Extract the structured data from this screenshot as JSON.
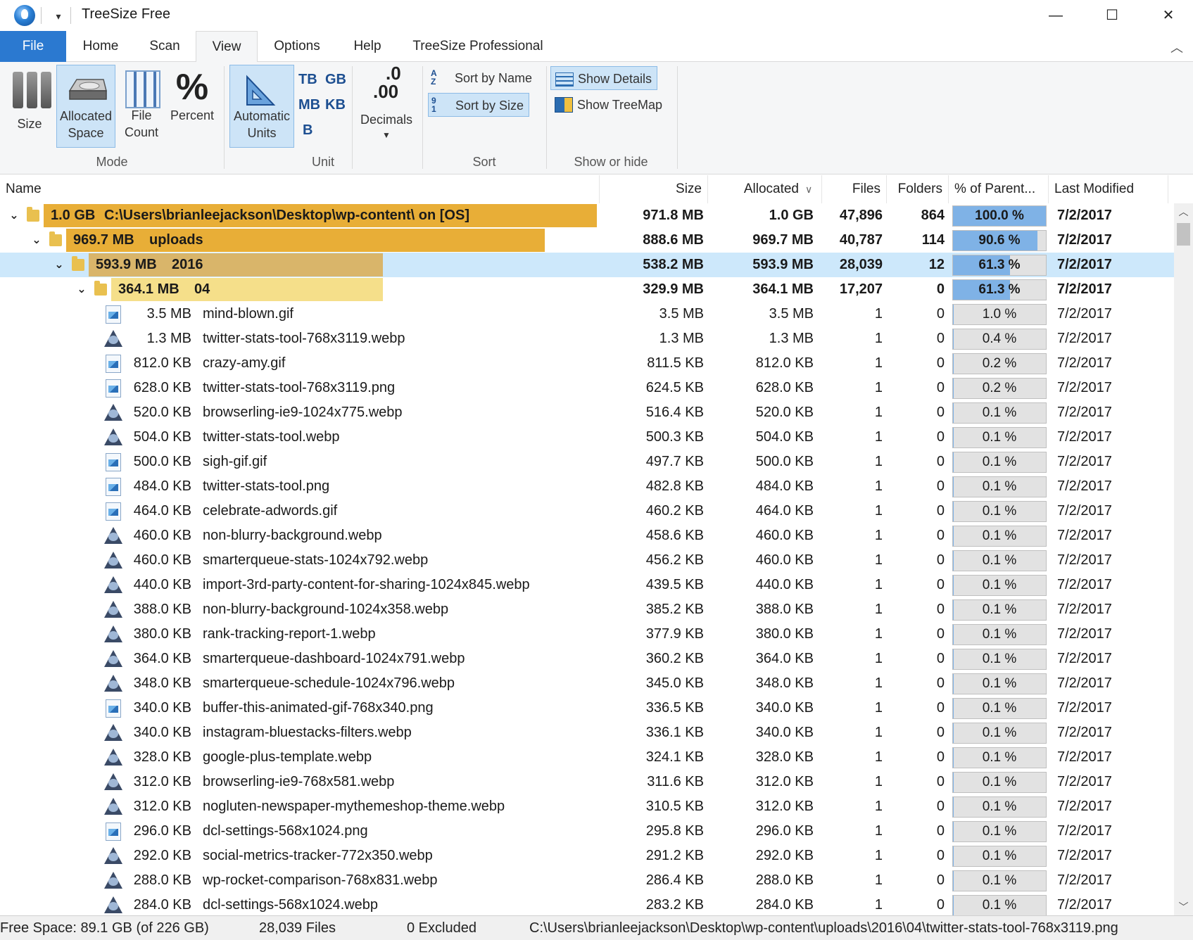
{
  "app": {
    "title": "TreeSize Free",
    "window_controls": {
      "minimize": "—",
      "maximize": "☐",
      "close": "✕"
    }
  },
  "tabs": [
    {
      "label": "File"
    },
    {
      "label": "Home"
    },
    {
      "label": "Scan"
    },
    {
      "label": "View"
    },
    {
      "label": "Options"
    },
    {
      "label": "Help"
    },
    {
      "label": "TreeSize Professional"
    }
  ],
  "ribbon": {
    "mode": {
      "group_label": "Mode",
      "size": "Size",
      "allocated_1": "Allocated",
      "allocated_2": "Space",
      "file_1": "File",
      "file_2": "Count",
      "percent": "Percent",
      "percent_glyph": "%"
    },
    "unit": {
      "group_label": "Unit",
      "auto_1": "Automatic",
      "auto_2": "Units",
      "tb": "TB",
      "gb": "GB",
      "mb": "MB",
      "kb": "KB",
      "b": "B",
      "decimals": "Decimals",
      "dec_top": ".0",
      "dec_bottom": ".00"
    },
    "sort": {
      "group_label": "Sort",
      "by_name": "Sort by Name",
      "by_size": "Sort by Size"
    },
    "show": {
      "group_label": "Show or hide",
      "details": "Show Details",
      "treemap": "Show TreeMap"
    }
  },
  "columns": {
    "name": "Name",
    "size": "Size",
    "allocated": "Allocated",
    "files": "Files",
    "folders": "Folders",
    "percent": "% of Parent...",
    "modified": "Last Modified"
  },
  "folders": [
    {
      "bar_label": "1.0 GB",
      "name": "C:\\Users\\brianleejackson\\Desktop\\wp-content\\  on  [OS]",
      "size": "971.8 MB",
      "allocated": "1.0 GB",
      "files": "47,896",
      "folders": "864",
      "percent": "100.0 %",
      "percent_value": 100.0,
      "modified": "7/2/2017",
      "bar_fraction": 1.0,
      "bar_color": "#e8ae37"
    },
    {
      "bar_label": "969.7 MB",
      "name": "uploads",
      "size": "888.6 MB",
      "allocated": "969.7 MB",
      "files": "40,787",
      "folders": "114",
      "percent": "90.6 %",
      "percent_value": 90.6,
      "modified": "7/2/2017",
      "bar_fraction": 0.906,
      "bar_color": "#e8ae37"
    },
    {
      "bar_label": "593.9 MB",
      "name": "2016",
      "size": "538.2 MB",
      "allocated": "593.9 MB",
      "files": "28,039",
      "folders": "12",
      "percent": "61.3 %",
      "percent_value": 61.3,
      "modified": "7/2/2017",
      "bar_fraction": 0.613,
      "bar_color": "#d9b56a"
    },
    {
      "bar_label": "364.1 MB",
      "name": "04",
      "size": "329.9 MB",
      "allocated": "364.1 MB",
      "files": "17,207",
      "folders": "0",
      "percent": "61.3 %",
      "percent_value": 61.3,
      "modified": "7/2/2017",
      "bar_fraction": 0.613,
      "bar_color": "#f5df8a"
    }
  ],
  "files": [
    {
      "type": "image",
      "alloc_label": "3.5 MB",
      "name": "mind-blown.gif",
      "size": "3.5 MB",
      "allocated": "3.5 MB",
      "files": "1",
      "folders": "0",
      "percent": "1.0 %",
      "percent_value": 1.0,
      "modified": "7/2/2017"
    },
    {
      "type": "webp",
      "alloc_label": "1.3 MB",
      "name": "twitter-stats-tool-768x3119.webp",
      "size": "1.3 MB",
      "allocated": "1.3 MB",
      "files": "1",
      "folders": "0",
      "percent": "0.4 %",
      "percent_value": 0.4,
      "modified": "7/2/2017"
    },
    {
      "type": "image",
      "alloc_label": "812.0 KB",
      "name": "crazy-amy.gif",
      "size": "811.5 KB",
      "allocated": "812.0 KB",
      "files": "1",
      "folders": "0",
      "percent": "0.2 %",
      "percent_value": 0.2,
      "modified": "7/2/2017"
    },
    {
      "type": "image",
      "alloc_label": "628.0 KB",
      "name": "twitter-stats-tool-768x3119.png",
      "size": "624.5 KB",
      "allocated": "628.0 KB",
      "files": "1",
      "folders": "0",
      "percent": "0.2 %",
      "percent_value": 0.2,
      "modified": "7/2/2017"
    },
    {
      "type": "webp",
      "alloc_label": "520.0 KB",
      "name": "browserling-ie9-1024x775.webp",
      "size": "516.4 KB",
      "allocated": "520.0 KB",
      "files": "1",
      "folders": "0",
      "percent": "0.1 %",
      "percent_value": 0.1,
      "modified": "7/2/2017"
    },
    {
      "type": "webp",
      "alloc_label": "504.0 KB",
      "name": "twitter-stats-tool.webp",
      "size": "500.3 KB",
      "allocated": "504.0 KB",
      "files": "1",
      "folders": "0",
      "percent": "0.1 %",
      "percent_value": 0.1,
      "modified": "7/2/2017"
    },
    {
      "type": "image",
      "alloc_label": "500.0 KB",
      "name": "sigh-gif.gif",
      "size": "497.7 KB",
      "allocated": "500.0 KB",
      "files": "1",
      "folders": "0",
      "percent": "0.1 %",
      "percent_value": 0.1,
      "modified": "7/2/2017"
    },
    {
      "type": "image",
      "alloc_label": "484.0 KB",
      "name": "twitter-stats-tool.png",
      "size": "482.8 KB",
      "allocated": "484.0 KB",
      "files": "1",
      "folders": "0",
      "percent": "0.1 %",
      "percent_value": 0.1,
      "modified": "7/2/2017"
    },
    {
      "type": "image",
      "alloc_label": "464.0 KB",
      "name": "celebrate-adwords.gif",
      "size": "460.2 KB",
      "allocated": "464.0 KB",
      "files": "1",
      "folders": "0",
      "percent": "0.1 %",
      "percent_value": 0.1,
      "modified": "7/2/2017"
    },
    {
      "type": "webp",
      "alloc_label": "460.0 KB",
      "name": "non-blurry-background.webp",
      "size": "458.6 KB",
      "allocated": "460.0 KB",
      "files": "1",
      "folders": "0",
      "percent": "0.1 %",
      "percent_value": 0.1,
      "modified": "7/2/2017"
    },
    {
      "type": "webp",
      "alloc_label": "460.0 KB",
      "name": "smarterqueue-stats-1024x792.webp",
      "size": "456.2 KB",
      "allocated": "460.0 KB",
      "files": "1",
      "folders": "0",
      "percent": "0.1 %",
      "percent_value": 0.1,
      "modified": "7/2/2017"
    },
    {
      "type": "webp",
      "alloc_label": "440.0 KB",
      "name": "import-3rd-party-content-for-sharing-1024x845.webp",
      "size": "439.5 KB",
      "allocated": "440.0 KB",
      "files": "1",
      "folders": "0",
      "percent": "0.1 %",
      "percent_value": 0.1,
      "modified": "7/2/2017"
    },
    {
      "type": "webp",
      "alloc_label": "388.0 KB",
      "name": "non-blurry-background-1024x358.webp",
      "size": "385.2 KB",
      "allocated": "388.0 KB",
      "files": "1",
      "folders": "0",
      "percent": "0.1 %",
      "percent_value": 0.1,
      "modified": "7/2/2017"
    },
    {
      "type": "webp",
      "alloc_label": "380.0 KB",
      "name": "rank-tracking-report-1.webp",
      "size": "377.9 KB",
      "allocated": "380.0 KB",
      "files": "1",
      "folders": "0",
      "percent": "0.1 %",
      "percent_value": 0.1,
      "modified": "7/2/2017"
    },
    {
      "type": "webp",
      "alloc_label": "364.0 KB",
      "name": "smarterqueue-dashboard-1024x791.webp",
      "size": "360.2 KB",
      "allocated": "364.0 KB",
      "files": "1",
      "folders": "0",
      "percent": "0.1 %",
      "percent_value": 0.1,
      "modified": "7/2/2017"
    },
    {
      "type": "webp",
      "alloc_label": "348.0 KB",
      "name": "smarterqueue-schedule-1024x796.webp",
      "size": "345.0 KB",
      "allocated": "348.0 KB",
      "files": "1",
      "folders": "0",
      "percent": "0.1 %",
      "percent_value": 0.1,
      "modified": "7/2/2017"
    },
    {
      "type": "image",
      "alloc_label": "340.0 KB",
      "name": "buffer-this-animated-gif-768x340.png",
      "size": "336.5 KB",
      "allocated": "340.0 KB",
      "files": "1",
      "folders": "0",
      "percent": "0.1 %",
      "percent_value": 0.1,
      "modified": "7/2/2017"
    },
    {
      "type": "webp",
      "alloc_label": "340.0 KB",
      "name": "instagram-bluestacks-filters.webp",
      "size": "336.1 KB",
      "allocated": "340.0 KB",
      "files": "1",
      "folders": "0",
      "percent": "0.1 %",
      "percent_value": 0.1,
      "modified": "7/2/2017"
    },
    {
      "type": "webp",
      "alloc_label": "328.0 KB",
      "name": "google-plus-template.webp",
      "size": "324.1 KB",
      "allocated": "328.0 KB",
      "files": "1",
      "folders": "0",
      "percent": "0.1 %",
      "percent_value": 0.1,
      "modified": "7/2/2017"
    },
    {
      "type": "webp",
      "alloc_label": "312.0 KB",
      "name": "browserling-ie9-768x581.webp",
      "size": "311.6 KB",
      "allocated": "312.0 KB",
      "files": "1",
      "folders": "0",
      "percent": "0.1 %",
      "percent_value": 0.1,
      "modified": "7/2/2017"
    },
    {
      "type": "webp",
      "alloc_label": "312.0 KB",
      "name": "nogluten-newspaper-mythemeshop-theme.webp",
      "size": "310.5 KB",
      "allocated": "312.0 KB",
      "files": "1",
      "folders": "0",
      "percent": "0.1 %",
      "percent_value": 0.1,
      "modified": "7/2/2017"
    },
    {
      "type": "image",
      "alloc_label": "296.0 KB",
      "name": "dcl-settings-568x1024.png",
      "size": "295.8 KB",
      "allocated": "296.0 KB",
      "files": "1",
      "folders": "0",
      "percent": "0.1 %",
      "percent_value": 0.1,
      "modified": "7/2/2017"
    },
    {
      "type": "webp",
      "alloc_label": "292.0 KB",
      "name": "social-metrics-tracker-772x350.webp",
      "size": "291.2 KB",
      "allocated": "292.0 KB",
      "files": "1",
      "folders": "0",
      "percent": "0.1 %",
      "percent_value": 0.1,
      "modified": "7/2/2017"
    },
    {
      "type": "webp",
      "alloc_label": "288.0 KB",
      "name": "wp-rocket-comparison-768x831.webp",
      "size": "286.4 KB",
      "allocated": "288.0 KB",
      "files": "1",
      "folders": "0",
      "percent": "0.1 %",
      "percent_value": 0.1,
      "modified": "7/2/2017"
    },
    {
      "type": "webp",
      "alloc_label": "284.0 KB",
      "name": "dcl-settings-568x1024.webp",
      "size": "283.2 KB",
      "allocated": "284.0 KB",
      "files": "1",
      "folders": "0",
      "percent": "0.1 %",
      "percent_value": 0.1,
      "modified": "7/2/2017"
    }
  ],
  "status": {
    "free_space": "Free Space: 89.1 GB  (of 226 GB)",
    "files": "28,039  Files",
    "excluded": "0 Excluded",
    "path": "C:\\Users\\brianleejackson\\Desktop\\wp-content\\uploads\\2016\\04\\twitter-stats-tool-768x3119.png"
  },
  "colors": {
    "accent": "#2b79d0",
    "selection": "#cde8fb",
    "percent_fill": "#7fb2e6"
  }
}
